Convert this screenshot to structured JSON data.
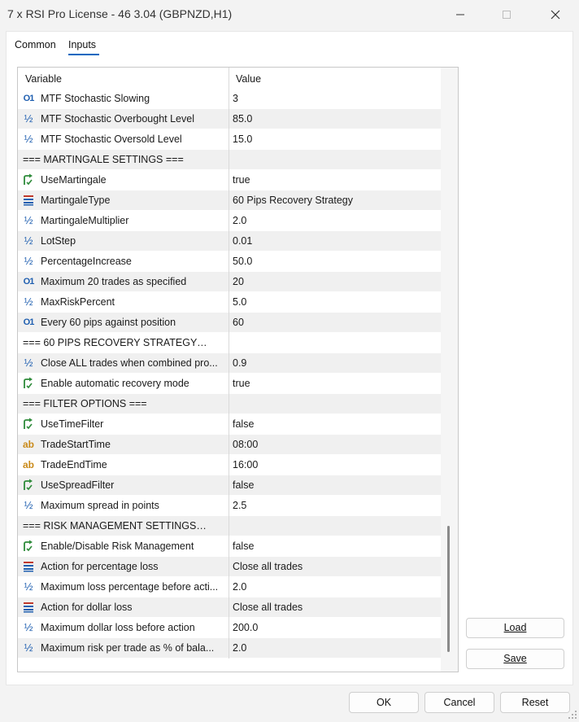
{
  "window": {
    "title": "7 x RSI Pro License - 46 3.04 (GBPNZD,H1)"
  },
  "tabs": [
    {
      "label": "Common"
    },
    {
      "label": "Inputs"
    }
  ],
  "grid": {
    "headers": {
      "variable": "Variable",
      "value": "Value"
    },
    "rows": [
      {
        "type": "int",
        "icon": "O1",
        "name": "MTF Stochastic Slowing",
        "value": "3"
      },
      {
        "type": "double",
        "icon": "½",
        "name": "MTF Stochastic Overbought Level",
        "value": "85.0"
      },
      {
        "type": "double",
        "icon": "½",
        "name": "MTF Stochastic Oversold Level",
        "value": "15.0"
      },
      {
        "type": "section",
        "icon": "",
        "name": "=== MARTINGALE SETTINGS ===",
        "value": ""
      },
      {
        "type": "bool",
        "icon": "",
        "name": "UseMartingale",
        "value": "true"
      },
      {
        "type": "enum",
        "icon": "",
        "name": "MartingaleType",
        "value": "60 Pips Recovery Strategy"
      },
      {
        "type": "double",
        "icon": "½",
        "name": "MartingaleMultiplier",
        "value": "2.0"
      },
      {
        "type": "double",
        "icon": "½",
        "name": "LotStep",
        "value": "0.01"
      },
      {
        "type": "double",
        "icon": "½",
        "name": "PercentageIncrease",
        "value": "50.0"
      },
      {
        "type": "int",
        "icon": "O1",
        "name": "Maximum 20 trades as specified",
        "value": "20"
      },
      {
        "type": "double",
        "icon": "½",
        "name": "MaxRiskPercent",
        "value": "5.0"
      },
      {
        "type": "int",
        "icon": "O1",
        "name": "Every 60 pips against position",
        "value": "60"
      },
      {
        "type": "section",
        "icon": "",
        "name": "=== 60 PIPS RECOVERY STRATEGY ===",
        "value": ""
      },
      {
        "type": "double",
        "icon": "½",
        "name": "Close ALL trades when combined pro...",
        "value": "0.9"
      },
      {
        "type": "bool",
        "icon": "",
        "name": "Enable automatic recovery mode",
        "value": "true"
      },
      {
        "type": "section",
        "icon": "",
        "name": "=== FILTER OPTIONS ===",
        "value": ""
      },
      {
        "type": "bool",
        "icon": "",
        "name": "UseTimeFilter",
        "value": "false"
      },
      {
        "type": "string",
        "icon": "ab",
        "name": "TradeStartTime",
        "value": "08:00"
      },
      {
        "type": "string",
        "icon": "ab",
        "name": "TradeEndTime",
        "value": "16:00"
      },
      {
        "type": "bool",
        "icon": "",
        "name": "UseSpreadFilter",
        "value": "false"
      },
      {
        "type": "double",
        "icon": "½",
        "name": "Maximum spread in points",
        "value": "2.5"
      },
      {
        "type": "section",
        "icon": "",
        "name": "=== RISK MANAGEMENT SETTINGS ===",
        "value": ""
      },
      {
        "type": "bool",
        "icon": "",
        "name": "Enable/Disable Risk Management",
        "value": "false"
      },
      {
        "type": "enum",
        "icon": "",
        "name": "Action for percentage loss",
        "value": "Close all trades"
      },
      {
        "type": "double",
        "icon": "½",
        "name": "Maximum loss percentage before acti...",
        "value": "2.0"
      },
      {
        "type": "enum",
        "icon": "",
        "name": "Action for dollar loss",
        "value": "Close all trades"
      },
      {
        "type": "double",
        "icon": "½",
        "name": "Maximum dollar loss before action",
        "value": "200.0"
      },
      {
        "type": "double",
        "icon": "½",
        "name": "Maximum risk per trade as % of bala...",
        "value": "2.0"
      }
    ]
  },
  "buttons": {
    "load": "Load",
    "save": "Save",
    "ok": "OK",
    "cancel": "Cancel",
    "reset": "Reset"
  },
  "colors": {
    "accent": "#0067c0",
    "icon_blue": "#1f5fb0",
    "icon_green": "#2e8b3a",
    "icon_orange": "#c98a1a",
    "row_alt": "#f0f0f0"
  }
}
